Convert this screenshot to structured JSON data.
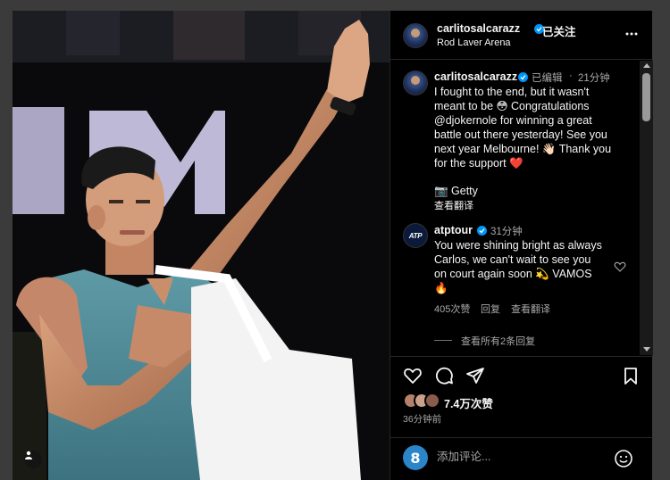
{
  "post": {
    "author": "carlitosalcarazz",
    "follow_label": "已关注",
    "location": "Rod Laver Arena",
    "more_icon": "more-horizontal-icon"
  },
  "caption": {
    "author": "carlitosalcarazz",
    "edited": "已编辑",
    "sep": "·",
    "time": "21分钟",
    "text_line1": "I fought to the end, but it wasn't",
    "text_line2": "meant to be 😳 Congratulations",
    "text_line3": "@djokernole for winning a great",
    "text_line4": "battle out there yesterday! See you",
    "text_line5": "next year Melbourne! 👋🏻 Thank you",
    "text_line6": "for the support ❤️",
    "credit": "📷 Getty",
    "translate": "查看翻译"
  },
  "comments": [
    {
      "author": "atptour",
      "avatar_text": "ATP",
      "time": "31分钟",
      "line1": "You were shining bright as always",
      "line2": "Carlos, we can't wait to see you",
      "line3": "on court again soon 💫 VAMOS",
      "line4": "🔥",
      "likes": "405次赞",
      "reply": "回复",
      "translate": "查看翻译",
      "view_replies": "查看所有2条回复"
    }
  ],
  "actions": {
    "likes": "7.4万次赞",
    "time_ago": "36分钟前",
    "icons": [
      "heart-icon",
      "comment-icon",
      "share-icon",
      "bookmark-icon"
    ]
  },
  "comment_box": {
    "placeholder": "添加评论...",
    "emoji_badge": "8"
  },
  "colors": {
    "verified": "#0095f6",
    "panel_bg": "#000000",
    "muted_text": "#a8a8a8"
  }
}
